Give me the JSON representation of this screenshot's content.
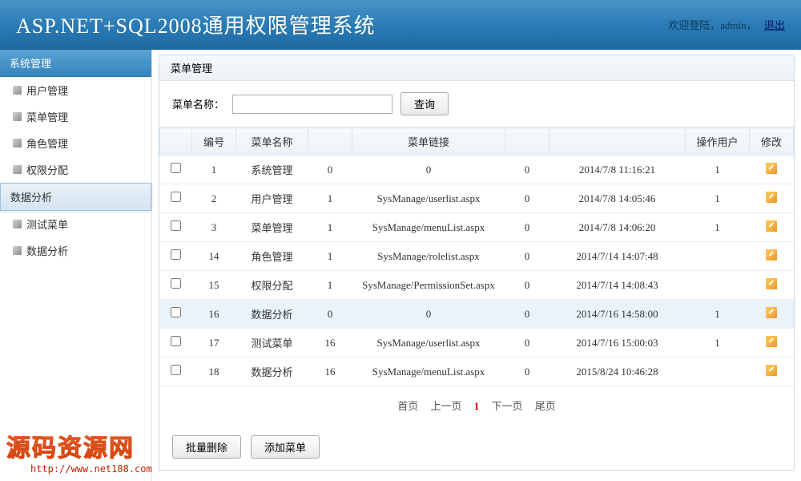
{
  "header": {
    "title": "ASP.NET+SQL2008通用权限管理系统",
    "welcome": "欢迎登陆，",
    "user": "admin",
    "logout": "退出"
  },
  "sidebar": {
    "groups": [
      {
        "title": "系统管理",
        "active": false,
        "items": [
          {
            "label": "用户管理"
          },
          {
            "label": "菜单管理"
          },
          {
            "label": "角色管理"
          },
          {
            "label": "权限分配"
          }
        ]
      },
      {
        "title": "数据分析",
        "active": true,
        "items": [
          {
            "label": "测试菜单"
          },
          {
            "label": "数据分析"
          }
        ]
      }
    ]
  },
  "panel": {
    "title": "菜单管理",
    "search_label": "菜单名称：",
    "search_value": "",
    "search_btn": "查询"
  },
  "table": {
    "headers": [
      "",
      "编号",
      "菜单名称",
      "",
      "菜单链接",
      "",
      "",
      "操作用户",
      "修改"
    ],
    "rows": [
      {
        "id": "1",
        "name": "系统管理",
        "c1": "0",
        "link": "0",
        "c2": "0",
        "time": "2014/7/8 11:16:21",
        "user": "1"
      },
      {
        "id": "2",
        "name": "用户管理",
        "c1": "1",
        "link": "SysManage/userlist.aspx",
        "c2": "0",
        "time": "2014/7/8 14:05:46",
        "user": "1"
      },
      {
        "id": "3",
        "name": "菜单管理",
        "c1": "1",
        "link": "SysManage/menuList.aspx",
        "c2": "0",
        "time": "2014/7/8 14:06:20",
        "user": "1"
      },
      {
        "id": "14",
        "name": "角色管理",
        "c1": "1",
        "link": "SysManage/rolelist.aspx",
        "c2": "0",
        "time": "2014/7/14 14:07:48",
        "user": ""
      },
      {
        "id": "15",
        "name": "权限分配",
        "c1": "1",
        "link": "SysManage/PermissionSet.aspx",
        "c2": "0",
        "time": "2014/7/14 14:08:43",
        "user": ""
      },
      {
        "id": "16",
        "name": "数据分析",
        "c1": "0",
        "link": "0",
        "c2": "0",
        "time": "2014/7/16 14:58:00",
        "user": "1",
        "highlight": true
      },
      {
        "id": "17",
        "name": "测试菜单",
        "c1": "16",
        "link": "SysManage/userlist.aspx",
        "c2": "0",
        "time": "2014/7/16 15:00:03",
        "user": "1"
      },
      {
        "id": "18",
        "name": "数据分析",
        "c1": "16",
        "link": "SysManage/menuList.aspx",
        "c2": "0",
        "time": "2015/8/24 10:46:28",
        "user": ""
      }
    ]
  },
  "pager": {
    "first": "首页",
    "prev": "上一页",
    "current": "1",
    "next": "下一页",
    "last": "尾页"
  },
  "actions": {
    "batch_delete": "批量删除",
    "add_menu": "添加菜单"
  },
  "watermark": {
    "text": "源码资源网",
    "url": "http://www.net188.com"
  }
}
